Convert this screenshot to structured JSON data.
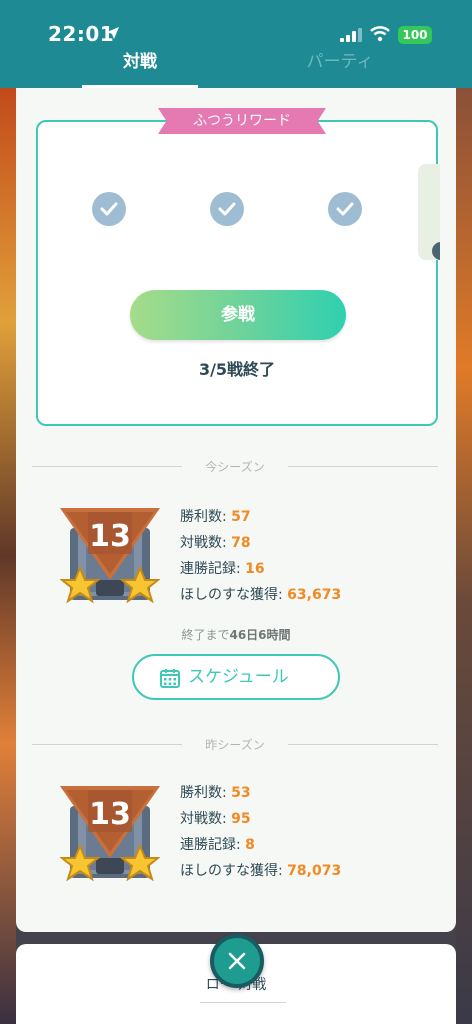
{
  "status_bar": {
    "time": "22:01",
    "battery": "100"
  },
  "tabs": [
    {
      "label": "対戦",
      "active": true
    },
    {
      "label": "パーティ",
      "active": false
    }
  ],
  "reward": {
    "ribbon": "ふつうリワード",
    "completed_checks": 3,
    "join_button": "参戦",
    "progress_text": "3/5戦終了"
  },
  "current_season": {
    "label": "今シーズン",
    "rank": "13",
    "stats": [
      {
        "label": "勝利数: ",
        "value": "57"
      },
      {
        "label": "対戦数: ",
        "value": "78"
      },
      {
        "label": "連勝記録: ",
        "value": "16"
      },
      {
        "label": "ほしのすな獲得: ",
        "value": "63,673"
      }
    ],
    "ends_in_prefix": "終了まで",
    "ends_in_value": "46日6時間",
    "schedule_button": "スケジュール"
  },
  "last_season": {
    "label": "昨シーズン",
    "rank": "13",
    "stats": [
      {
        "label": "勝利数: ",
        "value": "53"
      },
      {
        "label": "対戦数: ",
        "value": "95"
      },
      {
        "label": "連勝記録: ",
        "value": "8"
      },
      {
        "label": "ほしのすな獲得: ",
        "value": "78,073"
      }
    ]
  },
  "bottom_card": {
    "title": "ロー  対戦"
  },
  "colors": {
    "header": "#1e8b94",
    "accent": "#3ec8b6",
    "value_orange": "#f08a24",
    "ribbon_pink": "#e57ab3"
  },
  "icons": [
    "location-arrow-icon",
    "cellular-signal-icon",
    "wifi-icon",
    "battery-icon",
    "check-icon",
    "calendar-icon",
    "close-icon",
    "rank-badge-icon",
    "star-icon"
  ]
}
